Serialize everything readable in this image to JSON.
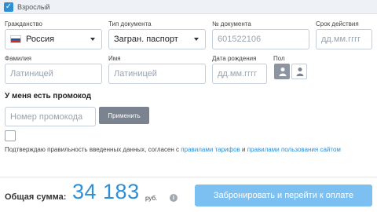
{
  "section": {
    "label": "Взрослый"
  },
  "fields": {
    "citizenship": {
      "label": "Гражданство",
      "value": "Россия"
    },
    "doc_type": {
      "label": "Тип документа",
      "value": "Загран. паспорт"
    },
    "doc_number": {
      "label": "№ документа",
      "placeholder": "601522106"
    },
    "expiry": {
      "label": "Срок действия",
      "placeholder": "дд.мм.гггг"
    },
    "last_name": {
      "label": "Фамилия",
      "placeholder": "Латиницей"
    },
    "first_name": {
      "label": "Имя",
      "placeholder": "Латиницей"
    },
    "birth_date": {
      "label": "Дата рождения",
      "placeholder": "дд.мм.гггг"
    },
    "gender": {
      "label": "Пол",
      "selected": "male"
    }
  },
  "promo": {
    "title": "У меня есть промокод",
    "placeholder": "Номер промокода",
    "apply_label": "Применить"
  },
  "agreement": {
    "text_before": "Подтверждаю правильность введенных данных, согласен с ",
    "link1": "правилами тарифов",
    "text_middle": " и ",
    "link2": "правилами пользования сайтом"
  },
  "footer": {
    "total_label": "Общая сумма:",
    "amount": "34 183",
    "currency": "руб.",
    "info_icon": "i",
    "book_label": "Забронировать и перейти к оплате"
  },
  "colors": {
    "accent": "#2d8fd5",
    "book_button": "#7bc0f0",
    "apply_button": "#7a838f"
  }
}
